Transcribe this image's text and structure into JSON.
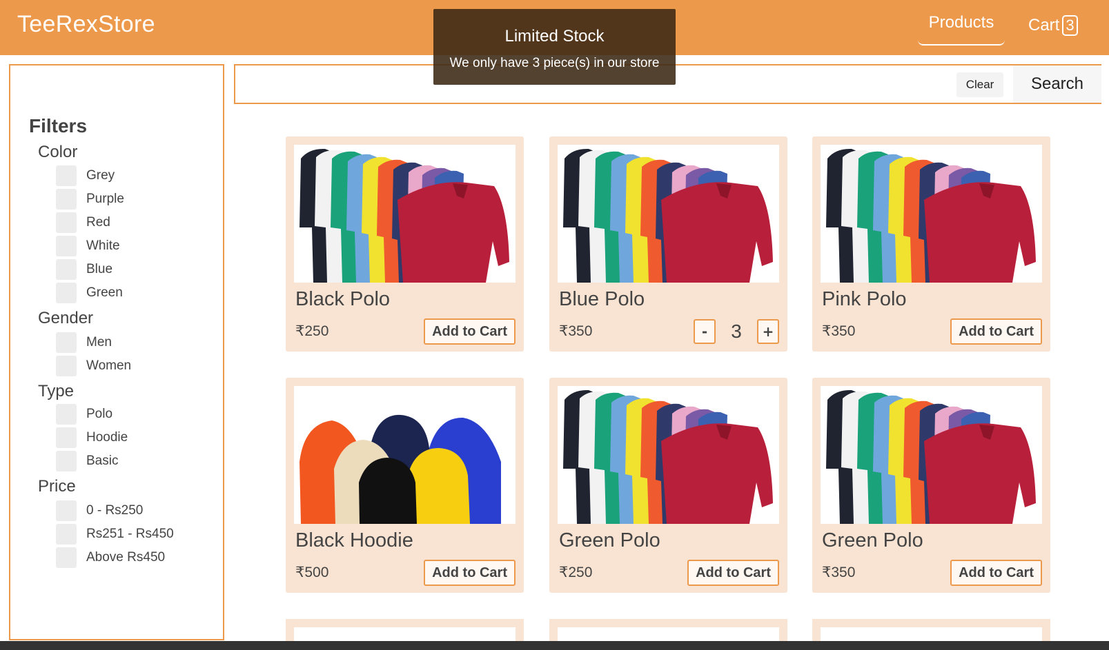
{
  "header": {
    "brand": "TeeRexStore",
    "nav_products": "Products",
    "nav_cart": "Cart",
    "cart_count": "3"
  },
  "toast": {
    "title": "Limited Stock",
    "message": "We only have 3 piece(s) in our store"
  },
  "search": {
    "value": "",
    "placeholder": "",
    "clear_label": "Clear",
    "search_label": "Search"
  },
  "filters": {
    "title": "Filters",
    "groups": [
      {
        "title": "Color",
        "options": [
          "Grey",
          "Purple",
          "Red",
          "White",
          "Blue",
          "Green"
        ]
      },
      {
        "title": "Gender",
        "options": [
          "Men",
          "Women"
        ]
      },
      {
        "title": "Type",
        "options": [
          "Polo",
          "Hoodie",
          "Basic"
        ]
      },
      {
        "title": "Price",
        "options": [
          "0 - Rs250",
          "Rs251 - Rs450",
          "Above Rs450"
        ]
      }
    ]
  },
  "products": [
    {
      "name": "Black Polo",
      "price": "₹250",
      "image": "polo-shirts",
      "action": "Add to Cart"
    },
    {
      "name": "Blue Polo",
      "price": "₹350",
      "image": "polo-shirts",
      "quantity": "3",
      "minus": "-",
      "plus": "+"
    },
    {
      "name": "Pink Polo",
      "price": "₹350",
      "image": "polo-shirts",
      "action": "Add to Cart"
    },
    {
      "name": "Black Hoodie",
      "price": "₹500",
      "image": "hoodies",
      "action": "Add to Cart"
    },
    {
      "name": "Green Polo",
      "price": "₹250",
      "image": "polo-shirts",
      "action": "Add to Cart"
    },
    {
      "name": "Green Polo",
      "price": "₹350",
      "image": "polo-shirts",
      "action": "Add to Cart"
    }
  ],
  "colors": {
    "accent": "#ec994b",
    "card_bg": "#f9e3d2"
  }
}
